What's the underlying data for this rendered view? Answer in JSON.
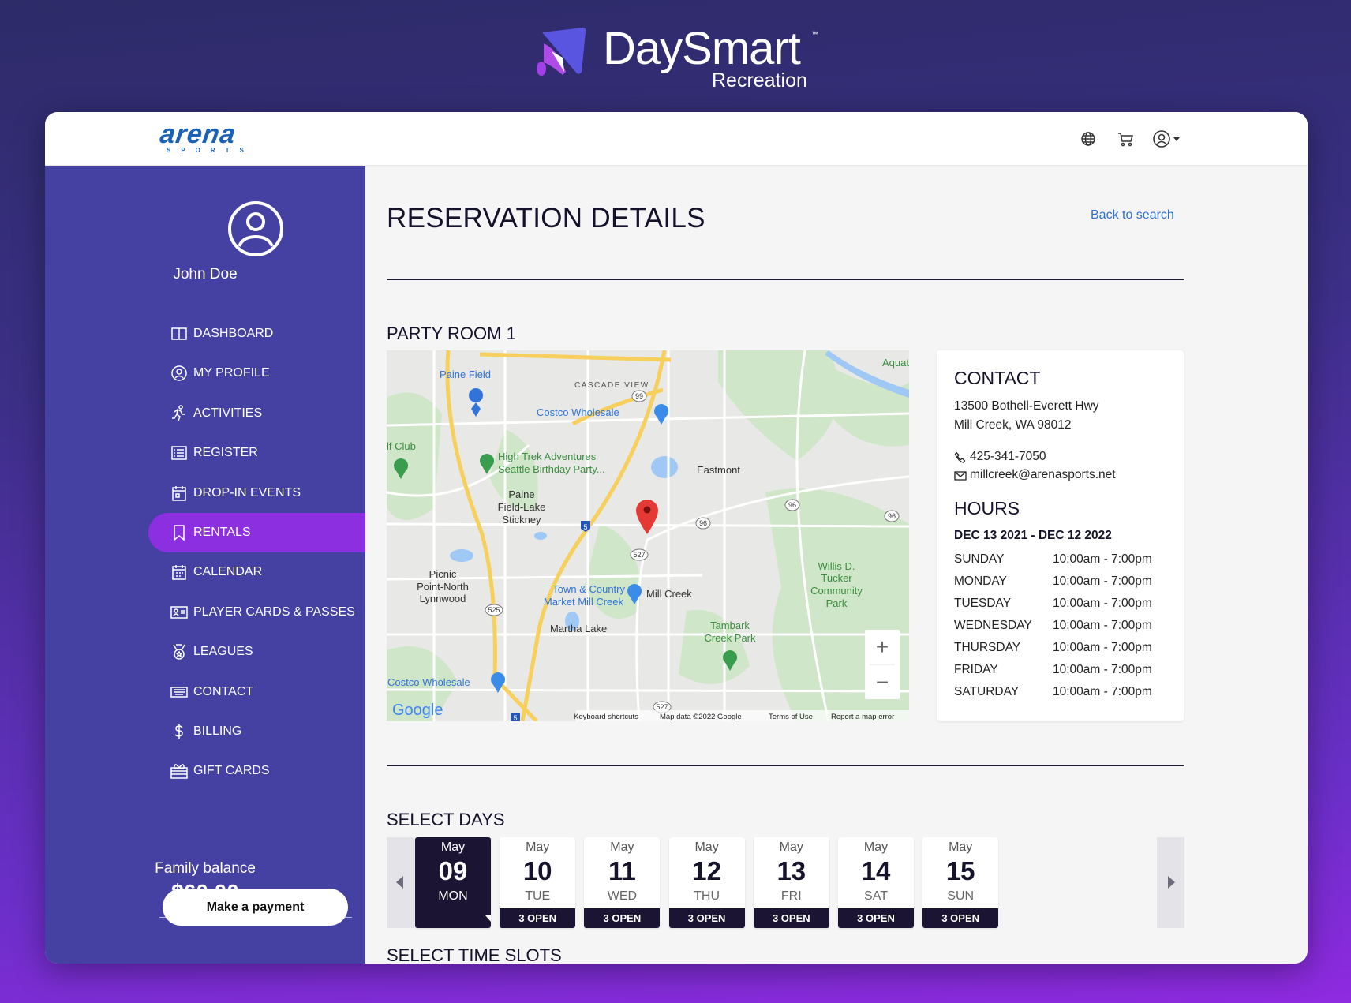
{
  "brand": {
    "name": "DaySmart",
    "tm": "™",
    "sub": "Recreation"
  },
  "header": {
    "logo": "arena",
    "logo_sub": "SPORTS",
    "icons": [
      "globe-icon",
      "cart-icon",
      "user-icon"
    ]
  },
  "sidebar": {
    "user_name": "John Doe",
    "items": [
      {
        "label": "DASHBOARD",
        "icon": "dashboard-icon"
      },
      {
        "label": "MY PROFILE",
        "icon": "profile-icon"
      },
      {
        "label": "ACTIVITIES",
        "icon": "running-icon"
      },
      {
        "label": "REGISTER",
        "icon": "list-icon"
      },
      {
        "label": "DROP-IN EVENTS",
        "icon": "calendar-event-icon"
      },
      {
        "label": "RENTALS",
        "icon": "bookmark-icon",
        "active": true
      },
      {
        "label": "CALENDAR",
        "icon": "calendar-icon"
      },
      {
        "label": "PLAYER CARDS & PASSES",
        "icon": "id-card-icon"
      },
      {
        "label": "LEAGUES",
        "icon": "medal-icon"
      },
      {
        "label": "CONTACT",
        "icon": "keyboard-icon"
      },
      {
        "label": "BILLING",
        "icon": "dollar-icon"
      },
      {
        "label": "GIFT CARDS",
        "icon": "gift-card-icon"
      }
    ],
    "balance_label": "Family balance",
    "balance": "$60.00",
    "payment_button": "Make a payment",
    "active_color": "#8c2fe0"
  },
  "main": {
    "title": "RESERVATION DETAILS",
    "back_link": "Back to search",
    "room": "PARTY ROOM 1",
    "select_days": "SELECT DAYS",
    "select_slots": "SELECT TIME SLOTS"
  },
  "map": {
    "labels": [
      "Paine Field",
      "CASCADE VIEW",
      "Costco Wholesale",
      "lf Club",
      "High Trek Adventures",
      "Seattle Birthday Party...",
      "Eastmont",
      "Paine",
      "Field-Lake",
      "Stickney",
      "Picnic",
      "Point-North",
      "Lynnwood",
      "Town & Country",
      "Market Mill Creek",
      "Mill Creek",
      "Martha Lake",
      "Willis D.",
      "Tucker",
      "Community",
      "Park",
      "Tambark",
      "Creek Park",
      "Costco Wholesale",
      "Aquat"
    ],
    "shields": [
      "99",
      "5",
      "96",
      "96",
      "96",
      "527",
      "525",
      "527",
      "5"
    ],
    "google": "Google",
    "attribution": [
      "Keyboard shortcuts",
      "Map data ©2022 Google",
      "Terms of Use",
      "Report a map error"
    ],
    "zoom_in": "+",
    "zoom_out": "−"
  },
  "contact": {
    "title": "CONTACT",
    "address1": "13500 Bothell-Everett Hwy",
    "address2": "Mill Creek, WA 98012",
    "phone": "425-341-7050",
    "email": "millcreek@arenasports.net",
    "hours_title": "HOURS",
    "range": "DEC 13 2021 - DEC 12 2022",
    "hours": [
      {
        "day": "SUNDAY",
        "time": "10:00am - 7:00pm"
      },
      {
        "day": "MONDAY",
        "time": "10:00am - 7:00pm"
      },
      {
        "day": "TUESDAY",
        "time": "10:00am - 7:00pm"
      },
      {
        "day": "WEDNESDAY",
        "time": "10:00am - 7:00pm"
      },
      {
        "day": "THURSDAY",
        "time": "10:00am - 7:00pm"
      },
      {
        "day": "FRIDAY",
        "time": "10:00am - 7:00pm"
      },
      {
        "day": "SATURDAY",
        "time": "10:00am - 7:00pm"
      }
    ]
  },
  "days": [
    {
      "month": "May",
      "date": "09",
      "dow": "MON",
      "selected": true
    },
    {
      "month": "May",
      "date": "10",
      "dow": "TUE",
      "open": "3 OPEN"
    },
    {
      "month": "May",
      "date": "11",
      "dow": "WED",
      "open": "3 OPEN"
    },
    {
      "month": "May",
      "date": "12",
      "dow": "THU",
      "open": "3 OPEN"
    },
    {
      "month": "May",
      "date": "13",
      "dow": "FRI",
      "open": "3 OPEN"
    },
    {
      "month": "May",
      "date": "14",
      "dow": "SAT",
      "open": "3 OPEN"
    },
    {
      "month": "May",
      "date": "15",
      "dow": "SUN",
      "open": "3 OPEN"
    }
  ]
}
